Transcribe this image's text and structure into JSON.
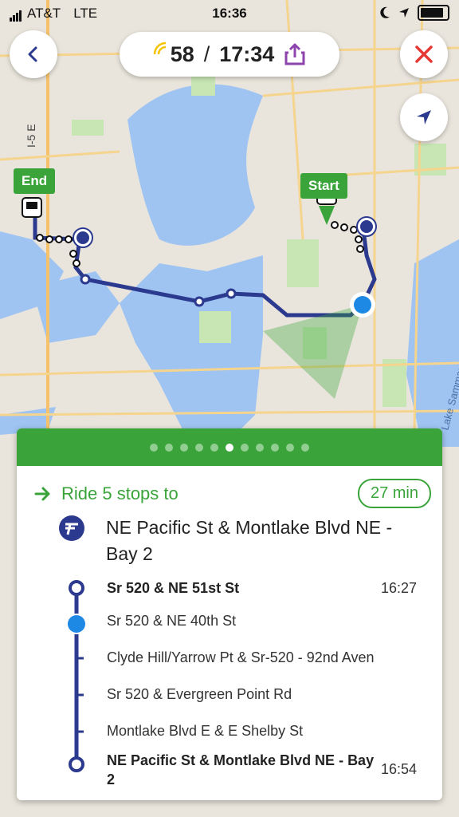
{
  "status_bar": {
    "carrier": "AT&T",
    "network": "LTE",
    "time": "16:36"
  },
  "header": {
    "current_time_value": "58",
    "separator": "/",
    "arrival_time": "17:34"
  },
  "map": {
    "end_label": "End",
    "start_label": "Start",
    "highway_label": "I-5 E",
    "lake_label": "Lake Sammam"
  },
  "step_indicator": {
    "total": 11,
    "active_index": 5
  },
  "trip": {
    "ride_text": "Ride 5 stops to",
    "duration": "27 min",
    "destination": "NE Pacific St & Montlake Blvd NE - Bay 2",
    "stops": [
      {
        "name": "Sr 520 & NE 51st St",
        "time": "16:27",
        "bold": true
      },
      {
        "name": "Sr 520 & NE 40th St",
        "time": "",
        "bold": false
      },
      {
        "name": "Clyde Hill/Yarrow Pt & Sr-520 - 92nd Aven",
        "time": "",
        "bold": false
      },
      {
        "name": "Sr 520 & Evergreen Point Rd",
        "time": "",
        "bold": false
      },
      {
        "name": "Montlake Blvd E & E Shelby St",
        "time": "",
        "bold": false
      },
      {
        "name": "NE Pacific St & Montlake Blvd NE - Bay 2",
        "time": "16:54",
        "bold": true
      }
    ]
  },
  "colors": {
    "brand_green": "#3aa43a",
    "route_blue": "#2b3a8f",
    "location_blue": "#1e88e5",
    "close_red": "#e53935",
    "share_purple": "#8e44ad"
  }
}
